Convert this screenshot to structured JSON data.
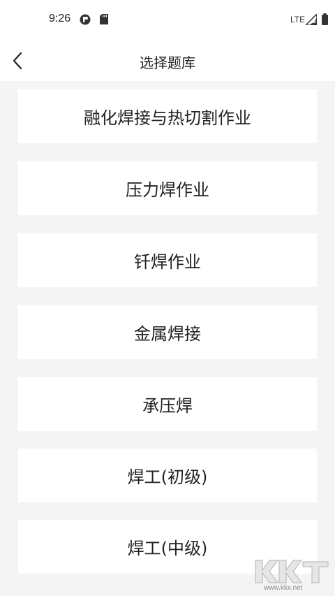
{
  "status_bar": {
    "time": "9:26",
    "network": "LTE",
    "icons": [
      "app-notification-icon",
      "sd-card-icon",
      "signal-icon",
      "battery-icon"
    ]
  },
  "nav": {
    "title": "选择题库",
    "back_icon": "chevron-left-icon"
  },
  "items": [
    {
      "label": "融化焊接与热切割作业"
    },
    {
      "label": "压力焊作业"
    },
    {
      "label": "钎焊作业"
    },
    {
      "label": "金属焊接"
    },
    {
      "label": "承压焊"
    },
    {
      "label": "焊工(初级)"
    },
    {
      "label": "焊工(中级)"
    }
  ],
  "watermark": {
    "logo": "KK下载",
    "text": "www.kkx.net"
  },
  "colors": {
    "background": "#f4f4f4",
    "card": "#ffffff",
    "text": "#222222"
  }
}
